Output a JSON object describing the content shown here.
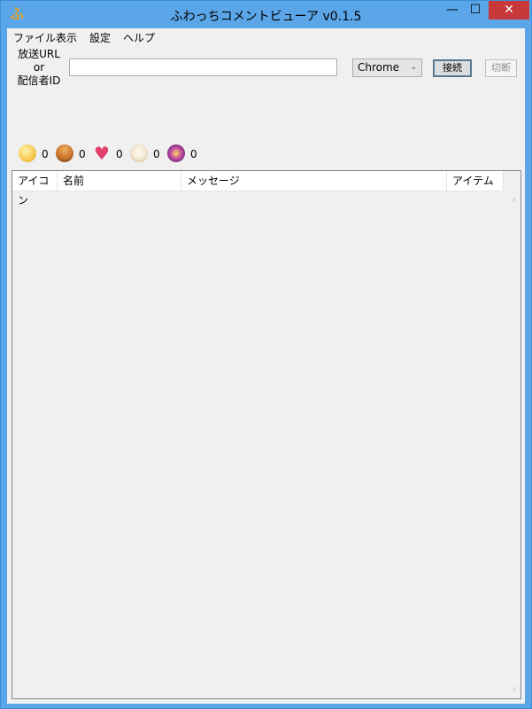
{
  "window": {
    "title": "ふわっちコメントビューア v0.1.5",
    "app_icon_glyph": "ふ",
    "controls": {
      "minimize": "—",
      "maximize": "☐",
      "close": "✕"
    }
  },
  "menu": [
    {
      "label": "ファイル"
    },
    {
      "label": "表示"
    },
    {
      "label": "設定"
    },
    {
      "label": "ヘルプ"
    }
  ],
  "connection": {
    "url_label_line1": "放送URL",
    "url_label_line2": "or",
    "url_label_line3": "配信者ID",
    "url_value": "",
    "browser_selected": "Chrome",
    "connect_label": "接続",
    "disconnect_label": "切断"
  },
  "items": [
    {
      "icon": "balloon-icon",
      "count": "0",
      "color": "#f5c84a"
    },
    {
      "icon": "burger-icon",
      "count": "0",
      "color": "#c8742c"
    },
    {
      "icon": "heart-icon",
      "count": "0",
      "color": "#e0406a"
    },
    {
      "icon": "ramen-icon",
      "count": "0",
      "color": "#f2e6d0"
    },
    {
      "icon": "firework-icon",
      "count": "0",
      "color": "#7a2fa0"
    }
  ],
  "comments": {
    "columns": [
      {
        "label": "アイコン"
      },
      {
        "label": "名前"
      },
      {
        "label": "メッセージ"
      },
      {
        "label": "アイテム"
      }
    ],
    "rows": []
  },
  "colors": {
    "titlebar": "#5aa6e8",
    "close_button": "#c7383a",
    "client_bg": "#f0f0f0"
  }
}
